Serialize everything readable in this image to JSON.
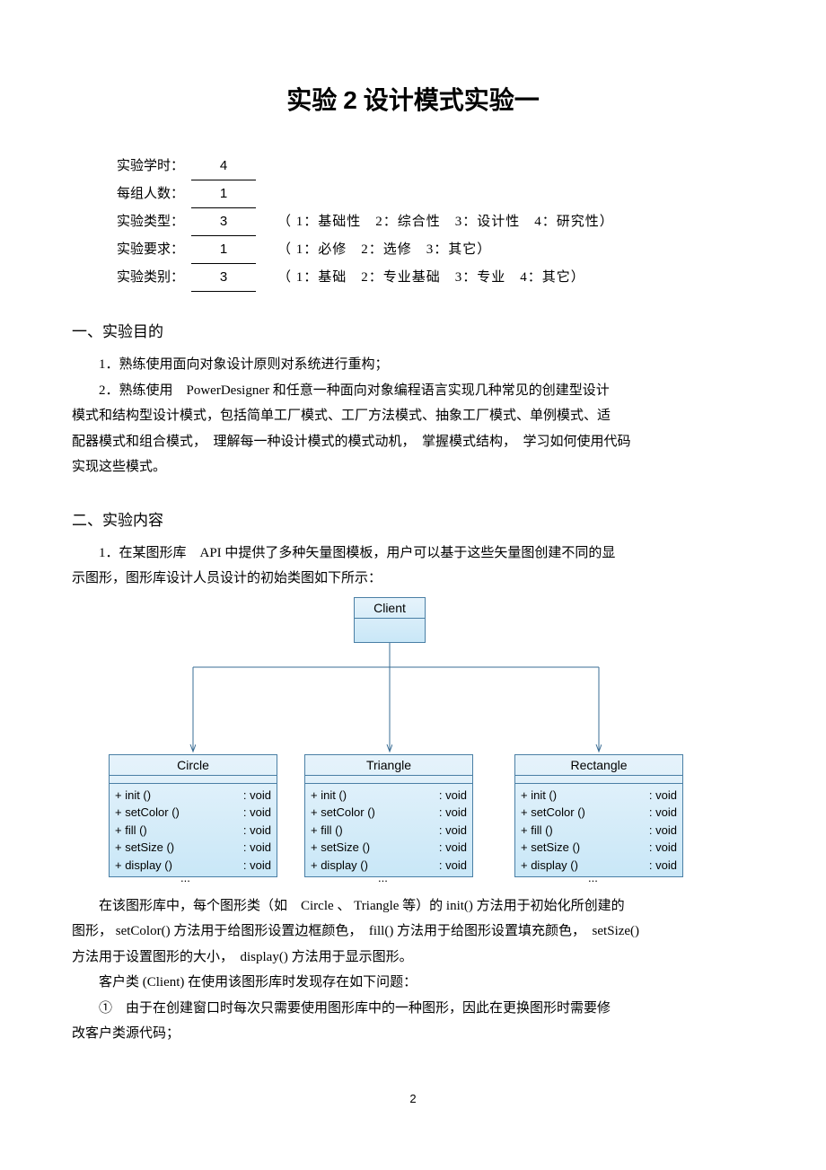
{
  "title_prefix": "实验 ",
  "title_num": "2",
  "title_suffix": " 设计模式实验一",
  "meta": {
    "hours_label": "实验学时：",
    "hours_value": "4",
    "group_label": "每组人数：",
    "group_value": "1",
    "type_label": "实验类型：",
    "type_value": "3",
    "type_legend": "（ 1：基础性　2：综合性　3：设计性　4：研究性）",
    "req_label": "实验要求：",
    "req_value": "1",
    "req_legend": "（ 1：必修　2：选修　3：其它）",
    "cat_label": "实验类别：",
    "cat_value": "3",
    "cat_legend": "（ 1：基础　2：专业基础　3：专业　4：其它）"
  },
  "sec1_title": "一、实验目的",
  "sec1_p1": "1．熟练使用面向对象设计原则对系统进行重构；",
  "sec1_p2a": "2．熟练使用　PowerDesigner 和任意一种面向对象编程语言实现几种常见的创建型设计",
  "sec1_p2b": "模式和结构型设计模式，包括简单工厂模式、工厂方法模式、抽象工厂模式、单例模式、适",
  "sec1_p2c": "配器模式和组合模式，　理解每一种设计模式的模式动机，　掌握模式结构，　学习如何使用代码",
  "sec1_p2d": "实现这些模式。",
  "sec2_title": "二、实验内容",
  "sec2_p1a": "1．在某图形库　API 中提供了多种矢量图模板，用户可以基于这些矢量图创建不同的显",
  "sec2_p1b": "示图形，图形库设计人员设计的初始类图如下所示：",
  "uml": {
    "client": "Client",
    "classes": [
      {
        "name": "Circle"
      },
      {
        "name": "Triangle"
      },
      {
        "name": "Rectangle"
      }
    ],
    "ops": [
      {
        "sig": "+ init ()",
        "ret": ": void"
      },
      {
        "sig": "+ setColor ()",
        "ret": ": void"
      },
      {
        "sig": "+ fill ()",
        "ret": ": void"
      },
      {
        "sig": "+ setSize ()",
        "ret": ": void"
      },
      {
        "sig": "+ display ()",
        "ret": ": void"
      }
    ],
    "ellipsis": "..."
  },
  "after_uml_p1": "在该图形库中，每个图形类（如　Circle 、 Triangle 等）的 init() 方法用于初始化所创建的",
  "after_uml_p2": "图形， setColor() 方法用于给图形设置边框颜色，　fill() 方法用于给图形设置填充颜色，　setSize()",
  "after_uml_p3": "方法用于设置图形的大小，　display() 方法用于显示图形。",
  "after_uml_p4": "客户类 (Client) 在使用该图形库时发现存在如下问题：",
  "after_uml_p5": "①　由于在创建窗口时每次只需要使用图形库中的一种图形，因此在更换图形时需要修",
  "after_uml_p6": "改客户类源代码；",
  "page_number": "2"
}
